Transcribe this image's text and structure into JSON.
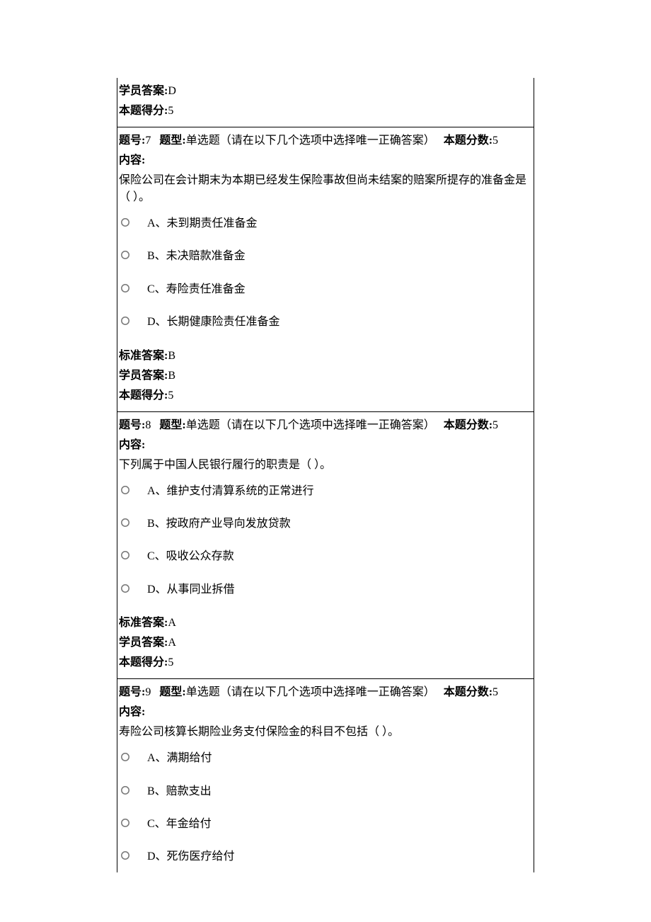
{
  "labels": {
    "question_no": "题号:",
    "question_type_label": "题型:",
    "question_type_value": "单选题（请在以下几个选项中选择唯一正确答案）",
    "score_label": "本题分数:",
    "content_label": "内容:",
    "standard_answer": "标准答案:",
    "student_answer": "学员答案:",
    "score_got": "本题得分:"
  },
  "top_cell": {
    "student_answer": "D",
    "score_got": "5"
  },
  "questions": [
    {
      "number": "7",
      "score": "5",
      "content": "保险公司在会计期末为本期已经发生保险事故但尚未结案的赔案所提存的准备金是（ ）。",
      "options": [
        "A、未到期责任准备金",
        "B、未决赔款准备金",
        "C、寿险责任准备金",
        "D、长期健康险责任准备金"
      ],
      "standard_answer": "B",
      "student_answer": "B",
      "score_got": "5"
    },
    {
      "number": "8",
      "score": "5",
      "content": "下列属于中国人民银行履行的职责是（ ）。",
      "options": [
        "A、维护支付清算系统的正常进行",
        "B、按政府产业导向发放贷款",
        "C、吸收公众存款",
        "D、从事同业拆借"
      ],
      "standard_answer": "A",
      "student_answer": "A",
      "score_got": "5"
    },
    {
      "number": "9",
      "score": "5",
      "content": "寿险公司核算长期险业务支付保险金的科目不包括（ ）。",
      "options": [
        "A、满期给付",
        "B、赔款支出",
        "C、年金给付",
        "D、死伤医疗给付"
      ]
    }
  ]
}
